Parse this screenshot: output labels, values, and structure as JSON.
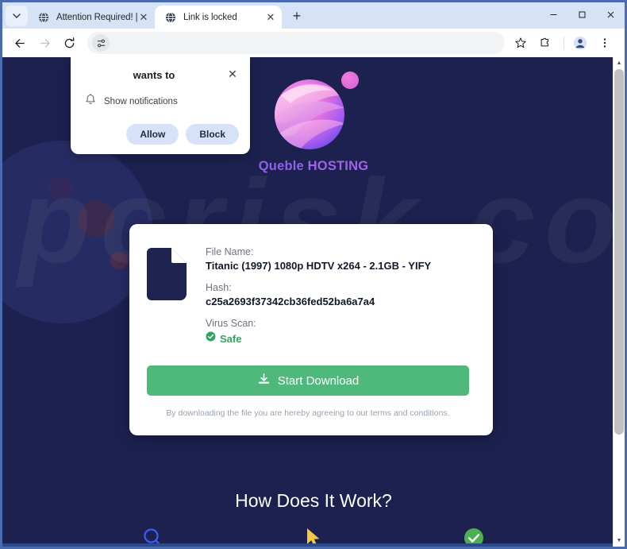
{
  "window": {
    "controls": [
      {
        "name": "minimize",
        "glyph": "–"
      },
      {
        "name": "maximize",
        "glyph": "□"
      },
      {
        "name": "close",
        "glyph": "✕"
      }
    ]
  },
  "tabs": {
    "tab_list_icon": "chevron-down-icon",
    "new_tab_label": "+",
    "items": [
      {
        "title": "Attention Required! | Cloudfla",
        "active": false,
        "favicon": "globe-icon",
        "close": "✕"
      },
      {
        "title": "Link is locked",
        "active": true,
        "favicon": "globe-icon",
        "close": "✕"
      }
    ]
  },
  "toolbar": {
    "back": "back-arrow-icon",
    "forward": "forward-arrow-icon",
    "reload": "reload-icon",
    "omnibox_value": "",
    "omnibox_placeholder": "",
    "tune_icon": "tune-icon",
    "bookmark": "star-icon",
    "extensions": "puzzle-icon",
    "profile": "avatar-icon",
    "menu": "three-dot-menu-icon"
  },
  "permission_popup": {
    "title": "wants to",
    "close_glyph": "✕",
    "request_icon": "bell-icon",
    "request_text": "Show notifications",
    "allow_label": "Allow",
    "block_label": "Block"
  },
  "page": {
    "background_color": "#1c2150",
    "watermark_text": "pcrisk.com",
    "logo": {
      "icon": "queble-orb-logo",
      "brand_part1": "Queble",
      "brand_part2": " HOSTING",
      "brand_color": "#8e63e8"
    },
    "card": {
      "file_icon": "document-icon",
      "file_name_label": "File Name:",
      "file_name_value": "Titanic (1997) 1080p HDTV x264 - 2.1GB - YIFY",
      "hash_label": "Hash:",
      "hash_value": "c25a2693f37342cb36fed52ba6a7a4",
      "virus_scan_label": "Virus Scan:",
      "virus_scan_status": "Safe",
      "virus_scan_icon": "check-circle-icon",
      "virus_scan_color": "#36a15e",
      "download_button_label": "Start Download",
      "download_button_icon": "download-icon",
      "download_button_color": "#4fb97c",
      "disclaimer": "By downloading the file you are hereby agreeing to our terms and conditions."
    },
    "how_it_works": {
      "title": "How Does It Work?",
      "steps": [
        {
          "icon": "magnifier-icon",
          "color": "#3b5bf5"
        },
        {
          "icon": "cursor-arrow-icon",
          "color": "#f5c842"
        },
        {
          "icon": "check-circle-icon",
          "color": "#4caf50"
        }
      ]
    }
  },
  "scrollbar": {
    "up_glyph": "▲",
    "down_glyph": "▼"
  }
}
